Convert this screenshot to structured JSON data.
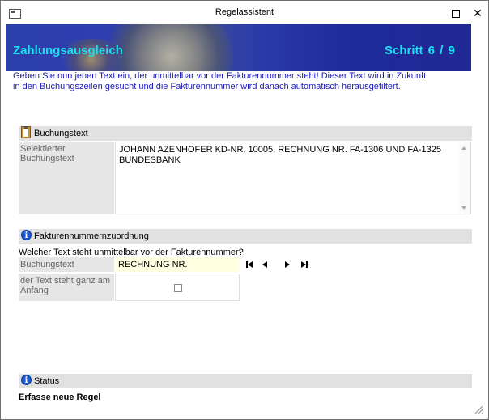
{
  "window": {
    "title": "Regelassistent",
    "maximize_icon": "maximize-icon",
    "close_icon": "close-icon",
    "close_glyph": "✕"
  },
  "banner": {
    "title": "Zahlungsausgleich",
    "step": "Schritt  6 / 9",
    "title_color": "#19e4f2",
    "background_color": "#2a3aa8"
  },
  "instructions": {
    "line1": "Geben Sie nun jenen Text ein, der unmittelbar vor der Fakturennummer steht! Dieser Text wird in Zukunft",
    "line2": "in den Buchungszeilen gesucht und die Fakturennummer wird danach automatisch herausgefiltert.",
    "color": "#1c1ab8"
  },
  "buchungstext_section": {
    "header": "Buchungstext",
    "icon": "clipboard-icon",
    "label": "Selektierter Buchungstext",
    "text_line1": "JOHANN AZENHOFER KD-NR. 10005,  RECHNUNG NR. FA-1306 UND FA-1325",
    "text_line2": "BUNDESBANK"
  },
  "faktura_section": {
    "header": "Fakturennummernzuordnung",
    "icon": "info-icon",
    "question": "Welcher Text steht unmittelbar vor der Fakturennummer?",
    "field_label": "Buchungstext",
    "field_value": "RECHNUNG NR.",
    "field_bg_color": "#ffffe1",
    "checkbox_label": "der Text steht ganz am Anfang",
    "checkbox_checked": false,
    "nav_buttons": [
      "first-icon",
      "previous-icon",
      "next-icon",
      "last-icon"
    ]
  },
  "status_section": {
    "header": "Status",
    "icon": "info-icon",
    "text": "Erfasse neue Regel"
  },
  "colors": {
    "section_header_bg": "#e1e1e1",
    "label_bg": "#e6e6e6"
  }
}
